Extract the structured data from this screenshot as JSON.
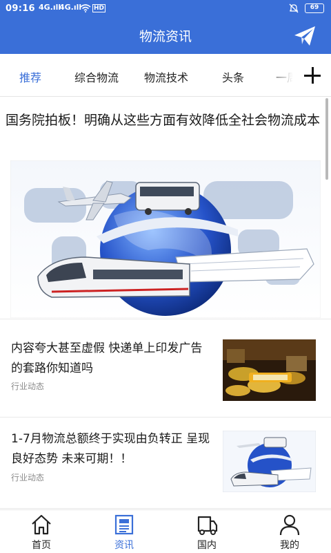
{
  "status_bar": {
    "time": "09:16",
    "signal_1": "4G.ıll",
    "signal_2": "4G.ıll",
    "network_badge": "HD",
    "battery": "69"
  },
  "header": {
    "title": "物流资讯",
    "action_icon": "paper-plane-icon"
  },
  "tabs": [
    {
      "label": "推荐",
      "active": true
    },
    {
      "label": "综合物流",
      "active": false
    },
    {
      "label": "物流技术",
      "active": false
    },
    {
      "label": "头条",
      "active": false
    },
    {
      "label": "一周",
      "active": false
    }
  ],
  "feed": {
    "featured": {
      "title": "国务院拍板！明确从这些方面有效降低全社会物流成本"
    },
    "items": [
      {
        "title": "内容夸大甚至虚假 快递单上印发广告的套路你知道吗",
        "tag": "行业动态"
      },
      {
        "title": "1-7月物流总额终于实现由负转正 呈现良好态势 未来可期！！",
        "tag": "行业动态"
      }
    ]
  },
  "bottom_nav": [
    {
      "label": "首页",
      "icon": "home-icon",
      "active": false
    },
    {
      "label": "资讯",
      "icon": "newspaper-icon",
      "active": true
    },
    {
      "label": "国内",
      "icon": "truck-icon",
      "active": false
    },
    {
      "label": "我的",
      "icon": "user-icon",
      "active": false
    }
  ],
  "colors": {
    "brand_blue": "#3a6fd8",
    "text": "#1a1a1a",
    "muted": "#8a8a8a"
  }
}
